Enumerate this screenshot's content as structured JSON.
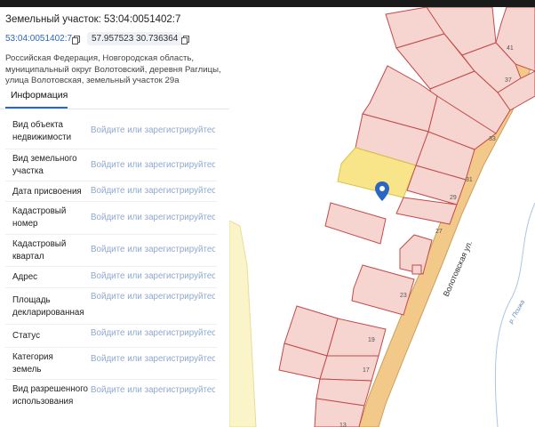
{
  "panel": {
    "title": "Земельный участок: 53:04:0051402:7",
    "cadastral_number": "53:04:0051402:7",
    "coordinates": "57.957523 30.736364",
    "address": "Российская Федерация, Новгородская область, муниципальный округ Волотовский, деревня Раглицы, улица Волотовская, земельный участок 29а",
    "tab_label": "Информация",
    "rows": [
      {
        "label": "Вид объекта недвижимости",
        "value": "Войдите или зарегистрируйтесь"
      },
      {
        "label": "Вид земельного участка",
        "value": "Войдите или зарегистрируйтесь"
      },
      {
        "label": "Дата присвоения",
        "value": "Войдите или зарегистрируйтесь"
      },
      {
        "label": "Кадастровый номер",
        "value": "Войдите или зарегистрируйтесь"
      },
      {
        "label": "Кадастровый квартал",
        "value": "Войдите или зарегистрируйтесь"
      },
      {
        "label": "Адрес",
        "value": "Войдите или зарегистрируйтесь"
      },
      {
        "label": "Площадь декларированная",
        "value": "Войдите или зарегистрируйтесь"
      },
      {
        "label": "Статус",
        "value": "Войдите или зарегистрируйтесь"
      },
      {
        "label": "Категория земель",
        "value": "Войдите или зарегистрируйтесь"
      },
      {
        "label": "Вид разрешенного использования",
        "value": "Войдите или зарегистрируйтесь"
      }
    ]
  },
  "map": {
    "street_label": "Волотовская ул.",
    "water_label": "р. Псижа",
    "parcel_numbers": [
      "41",
      "37",
      "33",
      "31",
      "29",
      "27",
      "23",
      "19",
      "17",
      "13"
    ],
    "colors": {
      "parcel_fill": "#f6d4cf",
      "parcel_border": "#c24a4a",
      "highlight_fill": "#f8e58a",
      "road": "#f3c98a",
      "marker": "#2a66c4"
    },
    "icons": [
      "location-marker-icon"
    ]
  }
}
